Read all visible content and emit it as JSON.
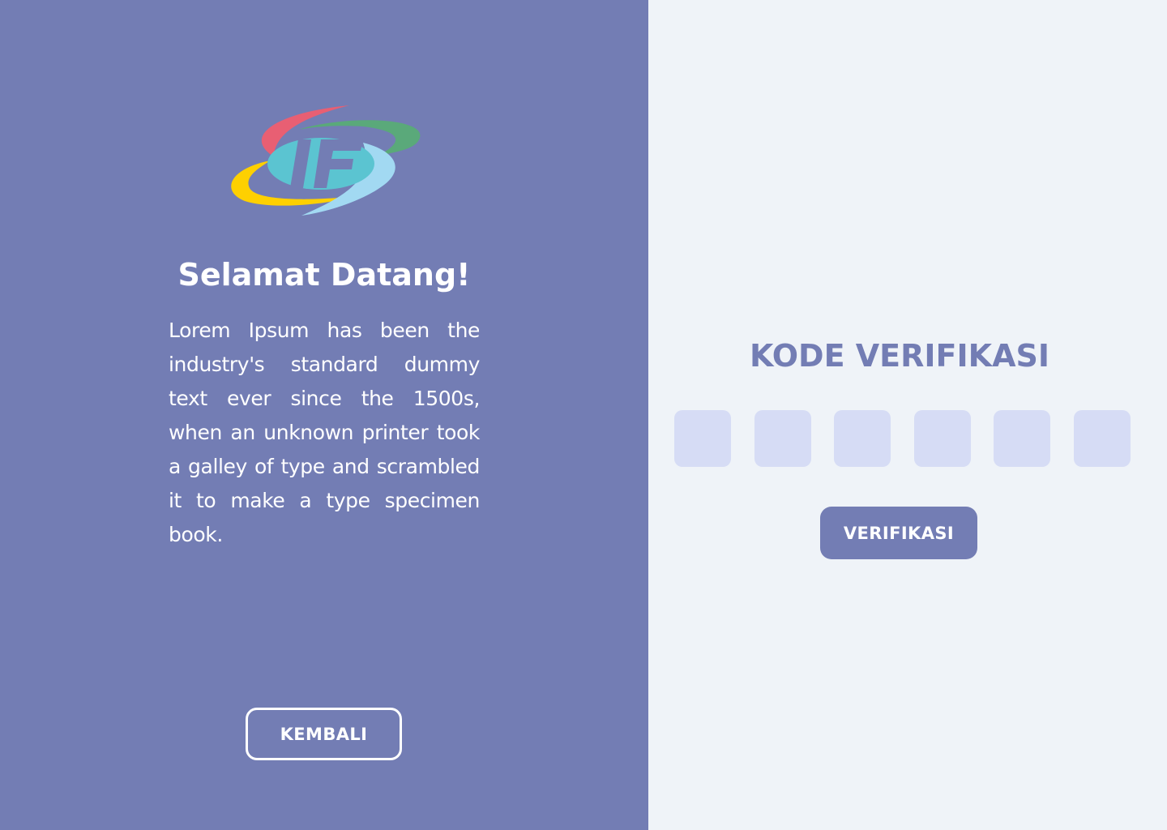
{
  "left_panel": {
    "logo": {
      "letters": "IF",
      "colors": {
        "red": "#e85f73",
        "green": "#5aa97a",
        "yellow": "#fed000",
        "light_blue": "#a2d9f2",
        "teal": "#5bc4d1",
        "letter": "#737db4"
      }
    },
    "title": "Selamat Datang!",
    "description": "Lorem Ipsum has been the industry's standard dummy text ever since the 1500s, when an unknown printer took a galley of type and scrambled it to make a type specimen book.",
    "back_button_label": "KEMBALI"
  },
  "right_panel": {
    "title": "KODE VERIFIKASI",
    "code_boxes": [
      "",
      "",
      "",
      "",
      "",
      ""
    ],
    "verify_button_label": "VERIFIKASI"
  },
  "colors": {
    "primary": "#737db4",
    "panel_background": "#eff3f8",
    "code_box_fill": "#d6dcf5",
    "text_light": "#ffffff"
  }
}
